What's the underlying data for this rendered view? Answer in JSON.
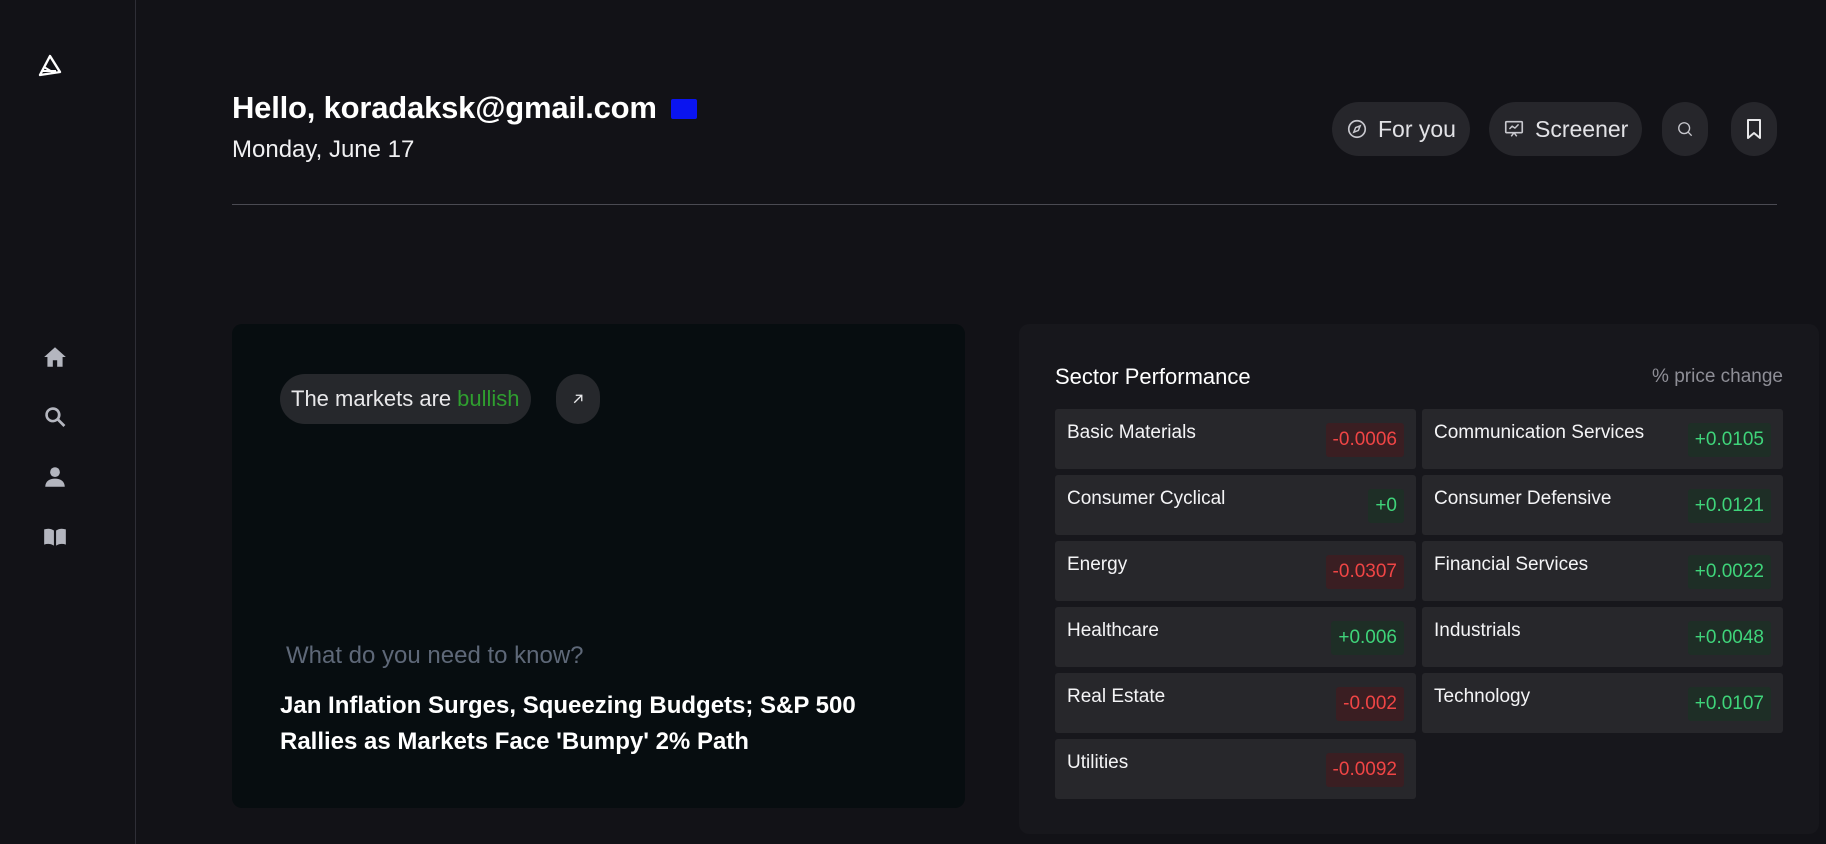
{
  "header": {
    "greeting": "Hello, koradaksk@gmail.com",
    "date": "Monday, June 17"
  },
  "nav": {
    "for_you": "For you",
    "screener": "Screener"
  },
  "hero": {
    "mood_prefix": "The markets are",
    "mood_value": "bullish",
    "ask_placeholder": "What do you need to know?",
    "headline": "Jan Inflation Surges, Squeezing Budgets; S&P 500 Rallies as Markets Face 'Bumpy' 2% Path"
  },
  "sector": {
    "title": "Sector Performance",
    "subtitle": "% price change",
    "items": [
      {
        "name": "Basic Materials",
        "value": "-0.0006",
        "trend": "neg"
      },
      {
        "name": "Communication Services",
        "value": "+0.0105",
        "trend": "pos"
      },
      {
        "name": "Consumer Cyclical",
        "value": "+0",
        "trend": "pos"
      },
      {
        "name": "Consumer Defensive",
        "value": "+0.0121",
        "trend": "pos"
      },
      {
        "name": "Energy",
        "value": "-0.0307",
        "trend": "neg"
      },
      {
        "name": "Financial Services",
        "value": "+0.0022",
        "trend": "pos"
      },
      {
        "name": "Healthcare",
        "value": "+0.006",
        "trend": "pos"
      },
      {
        "name": "Industrials",
        "value": "+0.0048",
        "trend": "pos"
      },
      {
        "name": "Real Estate",
        "value": "-0.002",
        "trend": "neg"
      },
      {
        "name": "Technology",
        "value": "+0.0107",
        "trend": "pos"
      },
      {
        "name": "Utilities",
        "value": "-0.0092",
        "trend": "neg"
      }
    ]
  },
  "colors": {
    "bullish": "#2f9e2f",
    "negative": "#f04545",
    "positive": "#3fd47a",
    "badge": "#0a14f0"
  },
  "icons": [
    "logo-icon",
    "home-icon",
    "search-icon",
    "user-icon",
    "book-icon",
    "compass-icon",
    "screener-icon",
    "bookmark-icon",
    "arrow-up-right-icon"
  ]
}
